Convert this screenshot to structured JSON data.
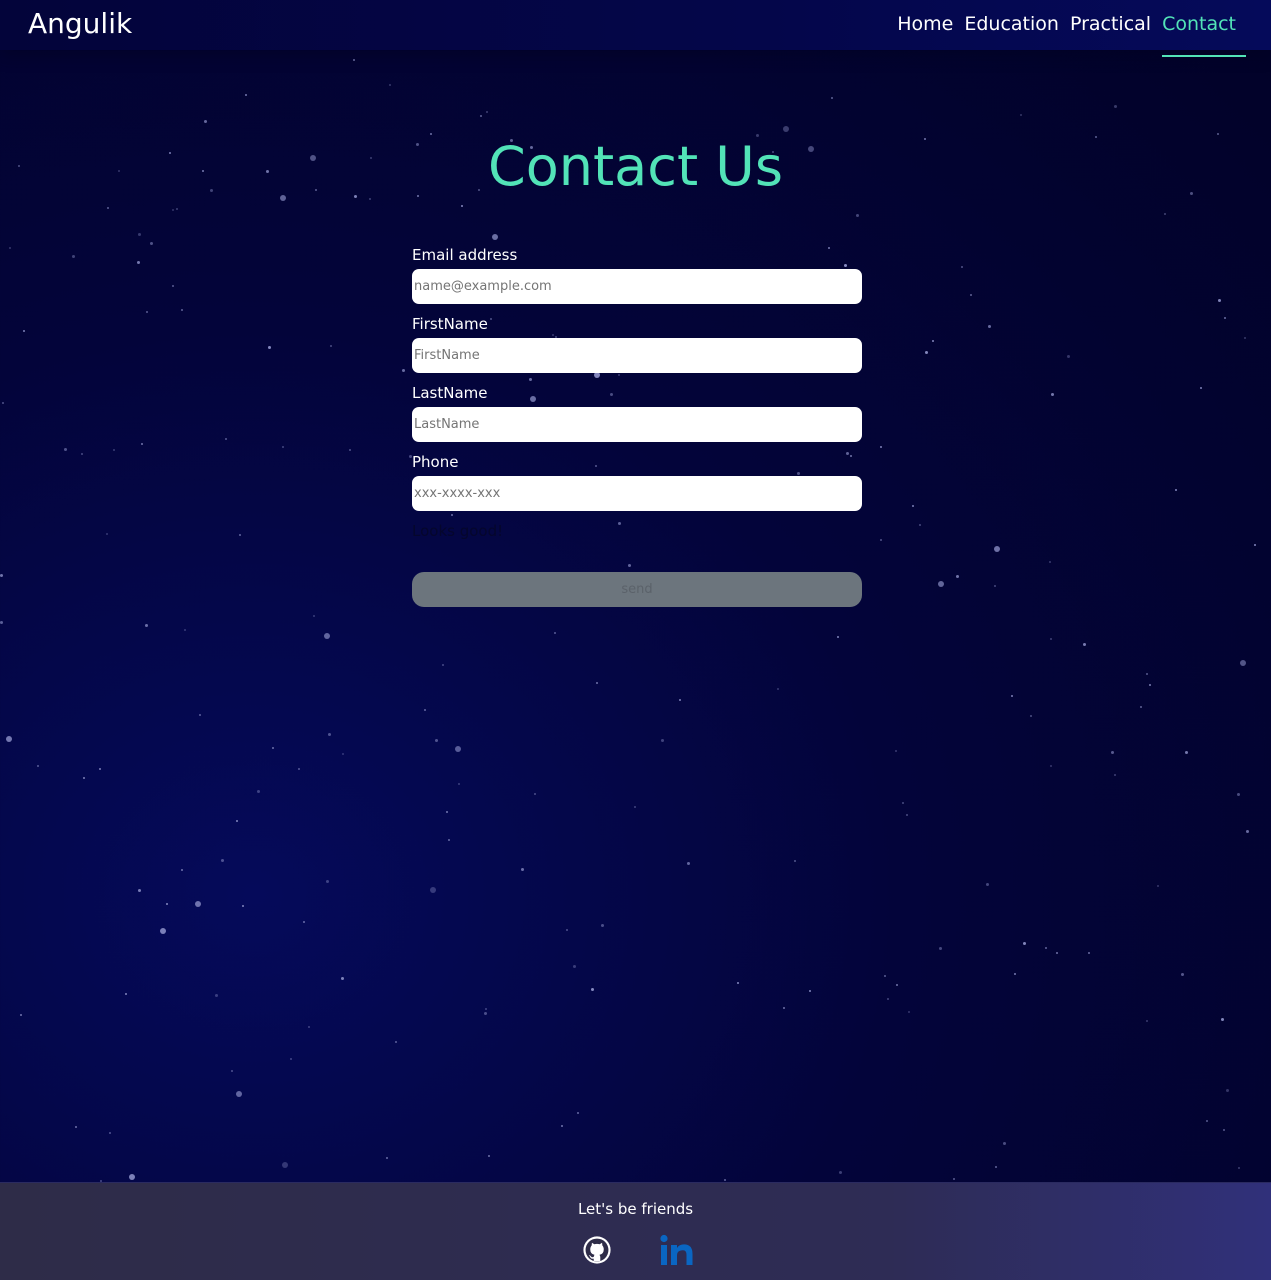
{
  "nav": {
    "brand": "Angulik",
    "links": [
      {
        "label": "Home",
        "active": false
      },
      {
        "label": "Education",
        "active": false
      },
      {
        "label": "Practical",
        "active": false
      },
      {
        "label": "Contact",
        "active": true
      }
    ]
  },
  "page": {
    "title": "Contact Us"
  },
  "form": {
    "email": {
      "label": "Email address",
      "placeholder": "name@example.com",
      "value": ""
    },
    "first_name": {
      "label": "FirstName",
      "placeholder": "FirstName",
      "value": ""
    },
    "last_name": {
      "label": "LastName",
      "placeholder": "LastName",
      "value": ""
    },
    "phone": {
      "label": "Phone",
      "placeholder": "xxx-xxxx-xxx",
      "value": ""
    },
    "status_note": "Looks good!",
    "send_label": "send"
  },
  "footer": {
    "title": "Let's be friends",
    "icons": {
      "github": "github-icon",
      "linkedin": "linkedin-icon"
    }
  },
  "colors": {
    "accent": "#52e3b7",
    "background": "#03043a",
    "button": "#6c757d",
    "linkedin": "#0a66c2"
  }
}
